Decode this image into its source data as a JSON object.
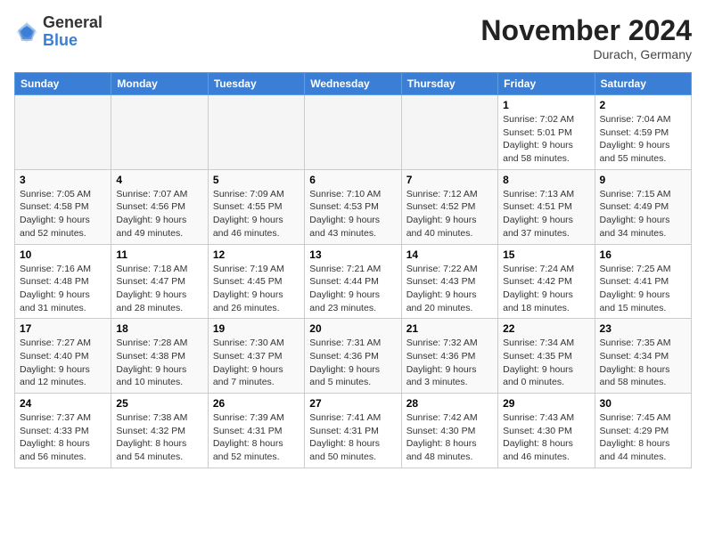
{
  "logo": {
    "general": "General",
    "blue": "Blue"
  },
  "title": "November 2024",
  "location": "Durach, Germany",
  "days_header": [
    "Sunday",
    "Monday",
    "Tuesday",
    "Wednesday",
    "Thursday",
    "Friday",
    "Saturday"
  ],
  "weeks": [
    [
      {
        "day": "",
        "info": ""
      },
      {
        "day": "",
        "info": ""
      },
      {
        "day": "",
        "info": ""
      },
      {
        "day": "",
        "info": ""
      },
      {
        "day": "",
        "info": ""
      },
      {
        "day": "1",
        "info": "Sunrise: 7:02 AM\nSunset: 5:01 PM\nDaylight: 9 hours and 58 minutes."
      },
      {
        "day": "2",
        "info": "Sunrise: 7:04 AM\nSunset: 4:59 PM\nDaylight: 9 hours and 55 minutes."
      }
    ],
    [
      {
        "day": "3",
        "info": "Sunrise: 7:05 AM\nSunset: 4:58 PM\nDaylight: 9 hours and 52 minutes."
      },
      {
        "day": "4",
        "info": "Sunrise: 7:07 AM\nSunset: 4:56 PM\nDaylight: 9 hours and 49 minutes."
      },
      {
        "day": "5",
        "info": "Sunrise: 7:09 AM\nSunset: 4:55 PM\nDaylight: 9 hours and 46 minutes."
      },
      {
        "day": "6",
        "info": "Sunrise: 7:10 AM\nSunset: 4:53 PM\nDaylight: 9 hours and 43 minutes."
      },
      {
        "day": "7",
        "info": "Sunrise: 7:12 AM\nSunset: 4:52 PM\nDaylight: 9 hours and 40 minutes."
      },
      {
        "day": "8",
        "info": "Sunrise: 7:13 AM\nSunset: 4:51 PM\nDaylight: 9 hours and 37 minutes."
      },
      {
        "day": "9",
        "info": "Sunrise: 7:15 AM\nSunset: 4:49 PM\nDaylight: 9 hours and 34 minutes."
      }
    ],
    [
      {
        "day": "10",
        "info": "Sunrise: 7:16 AM\nSunset: 4:48 PM\nDaylight: 9 hours and 31 minutes."
      },
      {
        "day": "11",
        "info": "Sunrise: 7:18 AM\nSunset: 4:47 PM\nDaylight: 9 hours and 28 minutes."
      },
      {
        "day": "12",
        "info": "Sunrise: 7:19 AM\nSunset: 4:45 PM\nDaylight: 9 hours and 26 minutes."
      },
      {
        "day": "13",
        "info": "Sunrise: 7:21 AM\nSunset: 4:44 PM\nDaylight: 9 hours and 23 minutes."
      },
      {
        "day": "14",
        "info": "Sunrise: 7:22 AM\nSunset: 4:43 PM\nDaylight: 9 hours and 20 minutes."
      },
      {
        "day": "15",
        "info": "Sunrise: 7:24 AM\nSunset: 4:42 PM\nDaylight: 9 hours and 18 minutes."
      },
      {
        "day": "16",
        "info": "Sunrise: 7:25 AM\nSunset: 4:41 PM\nDaylight: 9 hours and 15 minutes."
      }
    ],
    [
      {
        "day": "17",
        "info": "Sunrise: 7:27 AM\nSunset: 4:40 PM\nDaylight: 9 hours and 12 minutes."
      },
      {
        "day": "18",
        "info": "Sunrise: 7:28 AM\nSunset: 4:38 PM\nDaylight: 9 hours and 10 minutes."
      },
      {
        "day": "19",
        "info": "Sunrise: 7:30 AM\nSunset: 4:37 PM\nDaylight: 9 hours and 7 minutes."
      },
      {
        "day": "20",
        "info": "Sunrise: 7:31 AM\nSunset: 4:36 PM\nDaylight: 9 hours and 5 minutes."
      },
      {
        "day": "21",
        "info": "Sunrise: 7:32 AM\nSunset: 4:36 PM\nDaylight: 9 hours and 3 minutes."
      },
      {
        "day": "22",
        "info": "Sunrise: 7:34 AM\nSunset: 4:35 PM\nDaylight: 9 hours and 0 minutes."
      },
      {
        "day": "23",
        "info": "Sunrise: 7:35 AM\nSunset: 4:34 PM\nDaylight: 8 hours and 58 minutes."
      }
    ],
    [
      {
        "day": "24",
        "info": "Sunrise: 7:37 AM\nSunset: 4:33 PM\nDaylight: 8 hours and 56 minutes."
      },
      {
        "day": "25",
        "info": "Sunrise: 7:38 AM\nSunset: 4:32 PM\nDaylight: 8 hours and 54 minutes."
      },
      {
        "day": "26",
        "info": "Sunrise: 7:39 AM\nSunset: 4:31 PM\nDaylight: 8 hours and 52 minutes."
      },
      {
        "day": "27",
        "info": "Sunrise: 7:41 AM\nSunset: 4:31 PM\nDaylight: 8 hours and 50 minutes."
      },
      {
        "day": "28",
        "info": "Sunrise: 7:42 AM\nSunset: 4:30 PM\nDaylight: 8 hours and 48 minutes."
      },
      {
        "day": "29",
        "info": "Sunrise: 7:43 AM\nSunset: 4:30 PM\nDaylight: 8 hours and 46 minutes."
      },
      {
        "day": "30",
        "info": "Sunrise: 7:45 AM\nSunset: 4:29 PM\nDaylight: 8 hours and 44 minutes."
      }
    ]
  ]
}
